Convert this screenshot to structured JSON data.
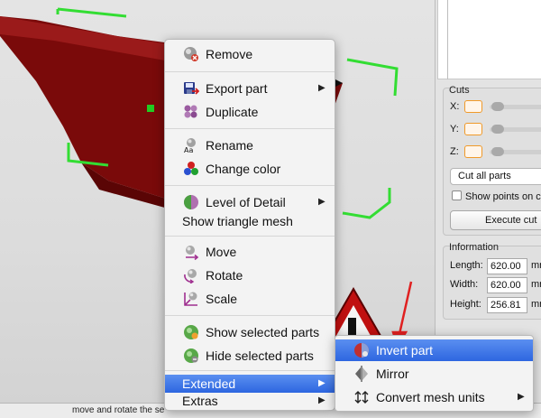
{
  "statusbar": {
    "text": "move and rotate the se"
  },
  "context_menu": {
    "items": [
      {
        "label": "Remove",
        "icon": "remove-icon"
      },
      {
        "label": "Export part",
        "icon": "export-part-icon",
        "submenu": true
      },
      {
        "label": "Duplicate",
        "icon": "duplicate-icon"
      },
      {
        "label": "Rename",
        "icon": "rename-icon"
      },
      {
        "label": "Change color",
        "icon": "change-color-icon"
      },
      {
        "label": "Level of Detail",
        "icon": "level-of-detail-icon",
        "submenu": true
      },
      {
        "label": "Show triangle mesh"
      },
      {
        "label": "Move",
        "icon": "move-icon"
      },
      {
        "label": "Rotate",
        "icon": "rotate-icon"
      },
      {
        "label": "Scale",
        "icon": "scale-icon"
      },
      {
        "label": "Show selected parts",
        "icon": "show-parts-icon"
      },
      {
        "label": "Hide selected parts",
        "icon": "hide-parts-icon"
      },
      {
        "label": "Extended",
        "submenu": true,
        "highlighted": true
      },
      {
        "label": "Extras",
        "submenu": true
      }
    ],
    "submenu_arrow": "▶"
  },
  "extended_submenu": {
    "items": [
      {
        "label": "Invert part",
        "icon": "invert-part-icon",
        "highlighted": true
      },
      {
        "label": "Mirror",
        "icon": "mirror-icon"
      },
      {
        "label": "Convert mesh units",
        "icon": "convert-units-icon",
        "submenu": true
      }
    ]
  },
  "cuts_panel": {
    "title": "Cuts",
    "axes": [
      "X:",
      "Y:",
      "Z:"
    ],
    "mode_select": "Cut all parts",
    "show_points_label": "Show points on c",
    "execute_button": "Execute cut"
  },
  "information_panel": {
    "title": "Information",
    "rows": [
      {
        "label": "Length:",
        "value": "620.00",
        "unit": "mr"
      },
      {
        "label": "Width:",
        "value": "620.00",
        "unit": "mr"
      },
      {
        "label": "Height:",
        "value": "256.81",
        "unit": "mr"
      }
    ]
  },
  "colors": {
    "part": "#7a0a0a",
    "selection": "#33dd33",
    "highlight": "#3a72e6",
    "axis_field": "#f09a2a",
    "annotation_arrow": "#e02020"
  }
}
